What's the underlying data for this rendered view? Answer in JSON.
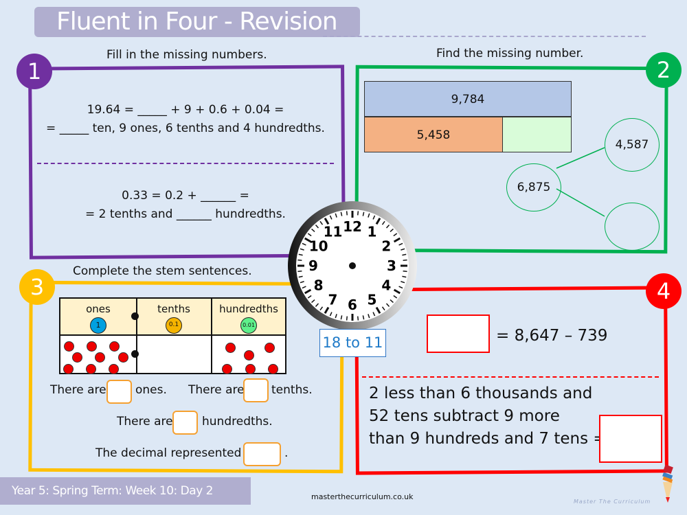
{
  "title": "Fluent in Four - Revision",
  "footer": {
    "label": "Year 5: Spring Term: Week 10: Day 2",
    "website": "masterthecurriculum.co.uk",
    "logo": "Master The Curriculum"
  },
  "q1": {
    "number": "1",
    "heading": "Fill in the missing numbers.",
    "line1": "19.64 = _____  + 9 + 0.6 + 0.04 =",
    "line2": "= _____ ten, 9 ones, 6 tenths and 4 hundredths.",
    "line3": "0.33 = 0.2 +  ______  =",
    "line4": "= 2 tenths and ______ hundredths.",
    "color": "#7030a0"
  },
  "q2": {
    "number": "2",
    "heading": "Find the missing number.",
    "bar_total": "9,784",
    "bar_part": "5,458",
    "bar_missing": "",
    "whole": "6,875",
    "part1": "4,587",
    "part2": "",
    "color": "#00b050"
  },
  "q3": {
    "number": "3",
    "heading": "Complete the stem sentences.",
    "columns": [
      {
        "label": "ones",
        "counter": "1",
        "counter_color": "#00a0e0",
        "dots": 9
      },
      {
        "label": "tenths",
        "counter": "0.1",
        "counter_color": "#f5b400",
        "dots": 0
      },
      {
        "label": "hundredths",
        "counter": "0.01",
        "counter_color": "#5ef08a",
        "dots": 6
      }
    ],
    "s1a": "There are",
    "s1b": "ones.",
    "s2a": "There are",
    "s2b": "tenths.",
    "s3a": "There are",
    "s3b": "hundredths.",
    "s4a": "The decimal represented is",
    "s4b": ".",
    "color": "#ffc000"
  },
  "q4": {
    "number": "4",
    "eq": "= 8,647 – 739",
    "line1": "2 less than 6 thousands and",
    "line2": "52 tens subtract 9 more",
    "line3": "than 9 hundreds and 7 tens =",
    "color": "#ff0000"
  },
  "clock": {
    "numbers": [
      "12",
      "1",
      "2",
      "3",
      "4",
      "5",
      "6",
      "7",
      "8",
      "9",
      "10",
      "11"
    ],
    "caption": "18 to 11"
  }
}
